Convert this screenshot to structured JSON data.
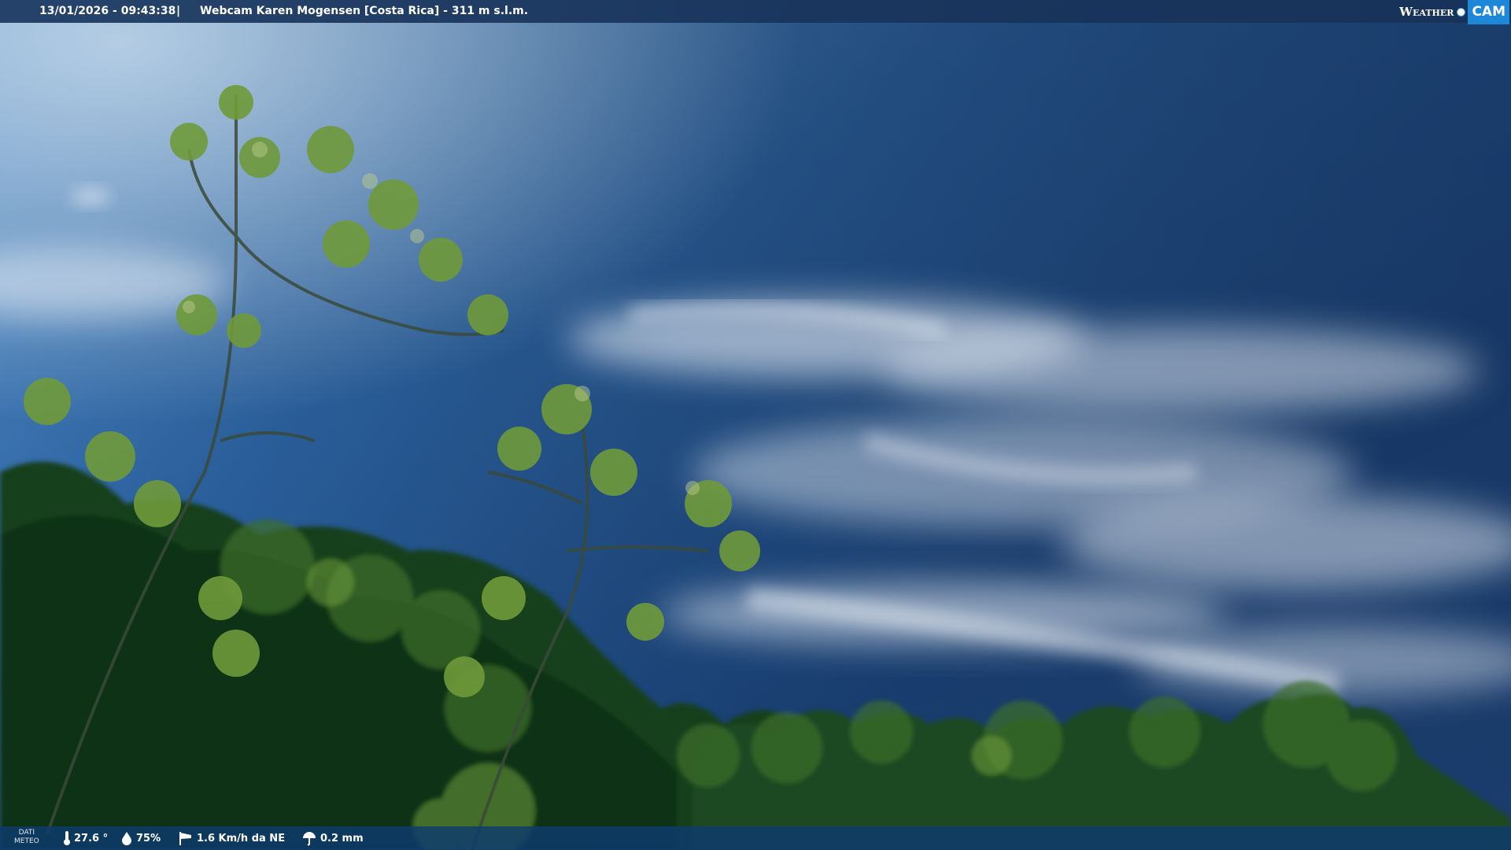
{
  "header": {
    "datetime": "13/01/2026 - 09:43:38",
    "separator": "|",
    "title": "Webcam Karen Mogensen [Costa Rica] - 311 m s.l.m."
  },
  "logo": {
    "weather": "Weather",
    "cam": "CAM"
  },
  "footer": {
    "dati_line1": "DATI",
    "dati_line2": "METEO",
    "temperature": "27.6 °",
    "humidity": "75%",
    "wind": "1.6 Km/h da NE",
    "rain": "0.2 mm"
  },
  "icons": {
    "temperature": "thermometer-icon",
    "humidity": "water-drop-icon",
    "wind": "wind-sock-icon",
    "rain": "umbrella-icon"
  },
  "colors": {
    "sky_top": "#1d3a66",
    "sky_mid": "#2d6cb0",
    "sky_horizon": "#9fc3e4",
    "foliage_dark": "#123a18",
    "foliage_light": "#6f9e3a",
    "bar": "#16375f"
  }
}
